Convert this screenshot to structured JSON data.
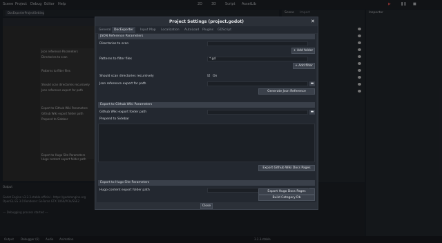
{
  "editor": {
    "menu": [
      "Scene",
      "Project",
      "Debug",
      "Editor",
      "Help"
    ],
    "workspaces": [
      "2D",
      "3D",
      "Script",
      "AssetLib"
    ],
    "scene_tab": "DocExporterProjectSettings.tscn",
    "left_list": [
      "Json reference Parameters",
      "Directories to scan",
      "Patterns to filter files",
      "Should scan directories recursively",
      "Json reference export for path",
      "Export to Github Wiki Parameters",
      "Github Wiki export folder path",
      "Prepend to Sidebar",
      "Export to Hugo Site Parameters",
      "Hugo content export folder path"
    ],
    "output_header": "Output",
    "output_lines": [
      "Godot Engine v3.2.3.stable.official - https://godotengine.org",
      "OpenGL ES 3.0 Renderer: GeForce GTX 1060/PCIe/SSE2",
      "--- Debugging process started ---"
    ],
    "status_items": [
      "Output",
      "Debugger (6)",
      "Audio",
      "Animation"
    ],
    "version": "3.2.3.stable",
    "right_dock_tabs": [
      "Scene",
      "Import"
    ],
    "inspector_tab": "Inspector"
  },
  "dialog": {
    "title": "Project Settings (project.godot)",
    "tabs": [
      "General",
      "DocExporter",
      "Input Map",
      "Localization",
      "AutoLoad",
      "Plugins",
      "GDScript"
    ],
    "active_tab": 1,
    "sections": {
      "json": {
        "header": "JSON Reference Parameters",
        "dirs_label": "Directories to scan",
        "add_folder": "Add folder",
        "patterns_label": "Patterns to filter files",
        "pattern_value": "*.gd",
        "add_filter": "Add filter",
        "recursive_label": "Should scan directories recursively",
        "recursive_value": "On",
        "export_label": "Json reference export for path",
        "generate_btn": "Generate Json Reference"
      },
      "github": {
        "header": "Export to Github Wiki Parameters",
        "folder_label": "Github Wiki export folder path",
        "prepend_label": "Prepend to Sidebar",
        "export_btn": "Export Github Wiki Docs Pages"
      },
      "hugo": {
        "header": "Export to Hugo Site Parameters",
        "folder_label": "Hugo content export folder path",
        "build_btn": "Build Category Db",
        "export_btn": "Export Hugo Docs Pages"
      }
    },
    "close_label": "Close"
  }
}
